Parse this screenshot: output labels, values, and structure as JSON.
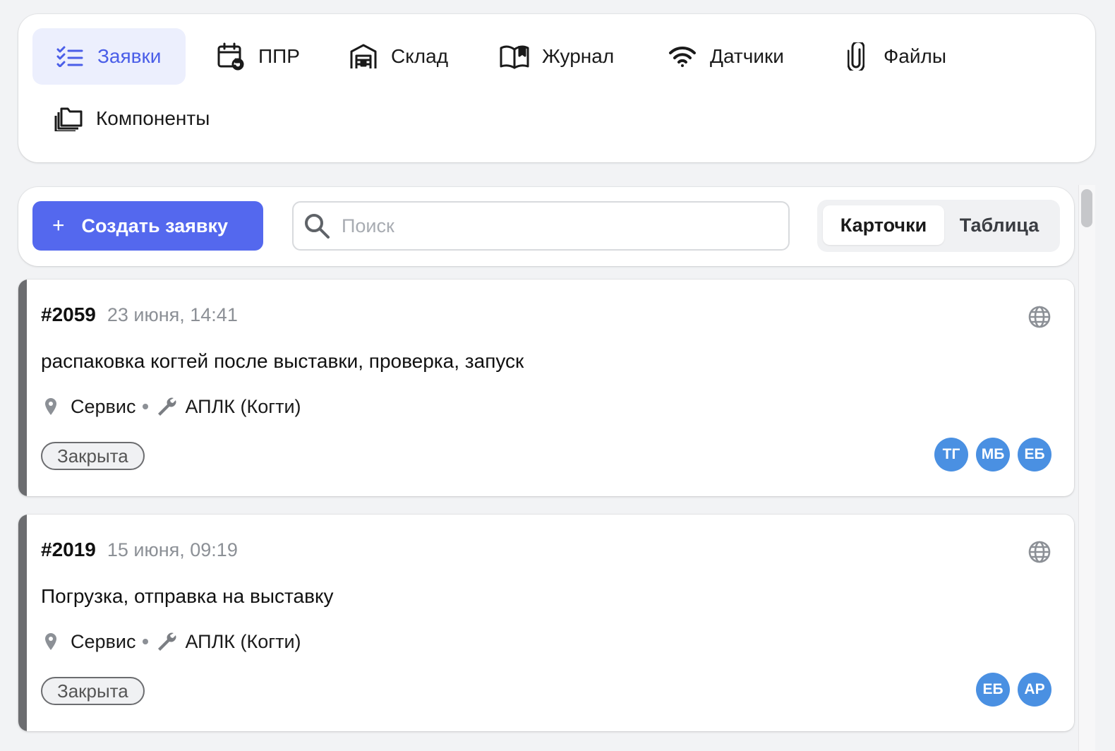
{
  "nav": {
    "items": [
      {
        "label": "Заявки",
        "icon": "checklist-icon",
        "active": true
      },
      {
        "label": "ППР",
        "icon": "calendar-refresh-icon",
        "active": false
      },
      {
        "label": "Склад",
        "icon": "warehouse-icon",
        "active": false
      },
      {
        "label": "Журнал",
        "icon": "book-icon",
        "active": false
      },
      {
        "label": "Датчики",
        "icon": "wifi-icon",
        "active": false
      },
      {
        "label": "Файлы",
        "icon": "paperclip-icon",
        "active": false
      },
      {
        "label": "Компоненты",
        "icon": "folders-icon",
        "active": false
      }
    ]
  },
  "toolbar": {
    "create_label": "Создать заявку",
    "create_icon": "+",
    "search_placeholder": "Поиск",
    "search_value": "",
    "view_cards": "Карточки",
    "view_table": "Таблица",
    "active_view": "Карточки"
  },
  "requests": [
    {
      "id": "#2059",
      "date": "23 июня, 14:41",
      "title": "распаковка когтей после выставки, проверка, запуск",
      "location": "Сервис",
      "equipment": "АПЛК (Когти)",
      "status": "Закрыта",
      "assignees": [
        "ТГ",
        "МБ",
        "ЕБ"
      ]
    },
    {
      "id": "#2019",
      "date": "15 июня, 09:19",
      "title": "Погрузка, отправка на выставку",
      "location": "Сервис",
      "equipment": "АПЛК (Когти)",
      "status": "Закрыта",
      "assignees": [
        "ЕБ",
        "АР"
      ]
    }
  ],
  "colors": {
    "accent": "#5468ee",
    "active_nav_bg": "#eceffd",
    "avatar": "#4a90e2",
    "card_stripe": "#6c6d70",
    "background": "#f2f3f5"
  }
}
